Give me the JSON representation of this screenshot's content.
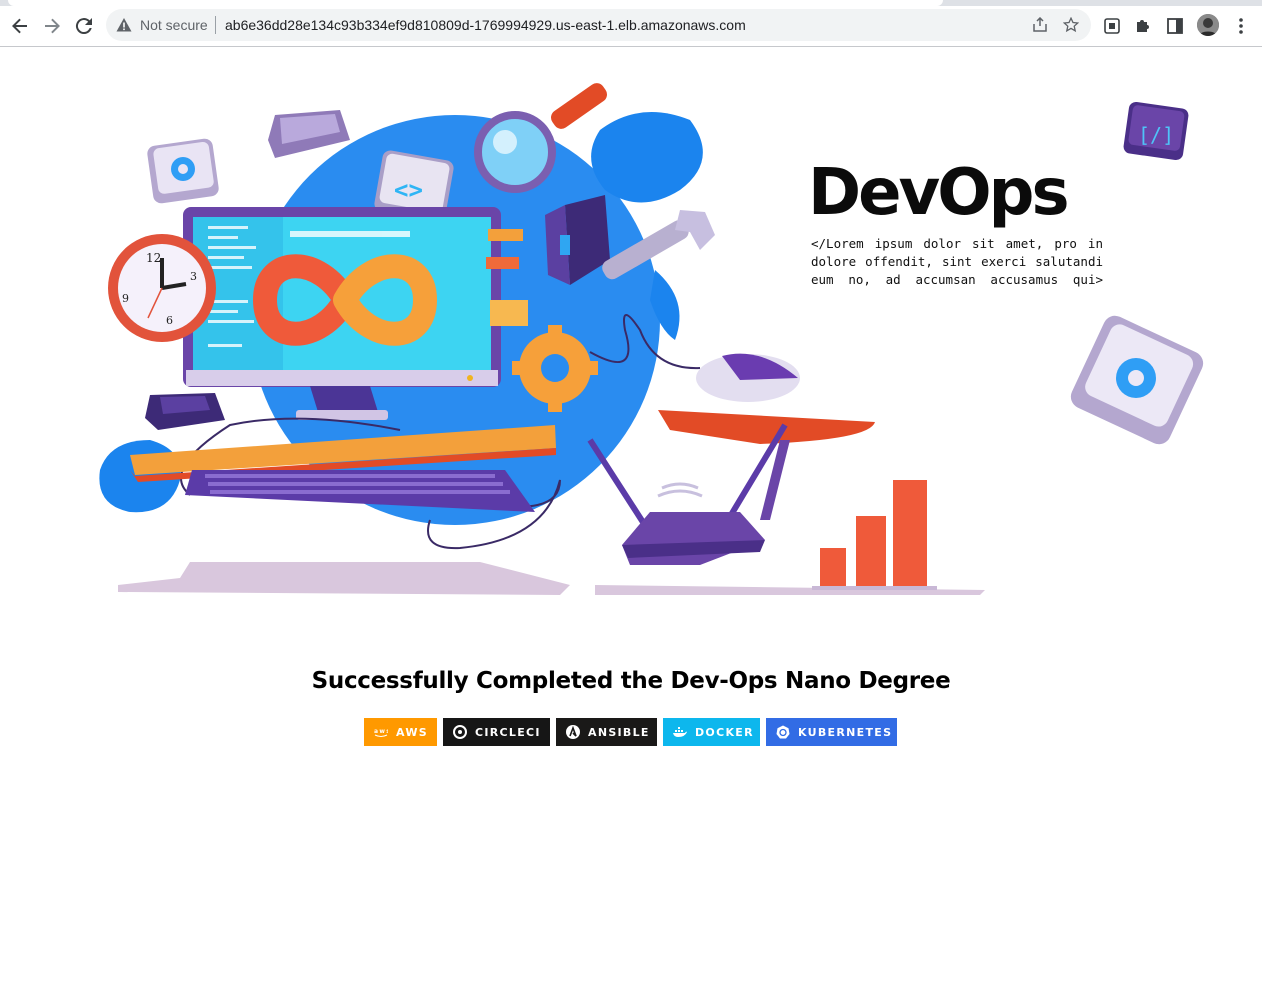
{
  "browser": {
    "security_label": "Not secure",
    "url": "ab6e36dd28e134c93b334ef9d810809d-1769994929.us-east-1.elb.amazonaws.com",
    "icons": [
      "back-icon",
      "forward-icon",
      "reload-icon",
      "warning-icon",
      "share-icon",
      "star-icon",
      "extension-puzzle-icon",
      "side-panel-icon",
      "profile-avatar",
      "menu-kebab-icon"
    ]
  },
  "hero": {
    "title": "DevOps",
    "lorem_lines": [
      "</Lorem ipsum dolor sit amet, pro in",
      "dolore offendit, sint exerci salutandi",
      "eum no, ad accumsan accusamus qui>"
    ]
  },
  "headline": "Successfully Completed the Dev-Ops Nano Degree",
  "badges": [
    {
      "label": "AWS",
      "color": "#ff9900",
      "icon": "aws-icon"
    },
    {
      "label": "CIRCLECI",
      "color": "#161616",
      "icon": "circleci-icon"
    },
    {
      "label": "ANSIBLE",
      "color": "#1a1918",
      "icon": "ansible-icon"
    },
    {
      "label": "DOCKER",
      "color": "#0db7ed",
      "icon": "docker-icon"
    },
    {
      "label": "KUBERNETES",
      "color": "#326ce5",
      "icon": "kubernetes-icon"
    }
  ]
}
